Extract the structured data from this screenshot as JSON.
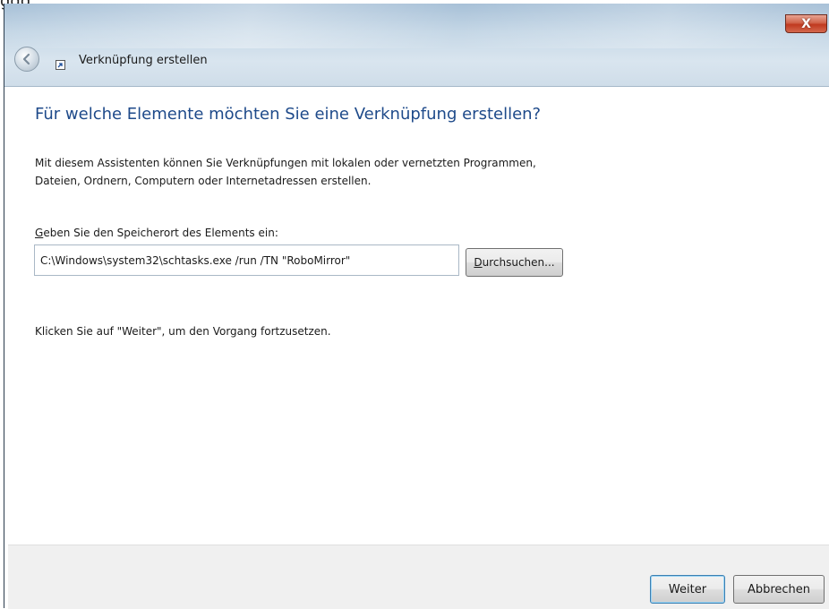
{
  "background_text": "ggg",
  "window": {
    "title": "Verknüpfung erstellen",
    "close_label": "X"
  },
  "content": {
    "heading": "Für welche Elemente möchten Sie eine Verknüpfung erstellen?",
    "description_line1": "Mit diesem Assistenten können Sie Verknüpfungen mit lokalen oder vernetzten Programmen,",
    "description_line2": "Dateien, Ordnern, Computern oder Internetadressen erstellen.",
    "field_label_accel": "G",
    "field_label_rest": "eben Sie den Speicherort des Elements ein:",
    "location_value": "C:\\Windows\\system32\\schtasks.exe /run /TN \"RoboMirror\"",
    "browse_accel": "D",
    "browse_rest": "urchsuchen...",
    "hint": "Klicken Sie auf \"Weiter\", um den Vorgang fortzusetzen."
  },
  "footer": {
    "next_label": "Weiter",
    "cancel_label": "Abbrechen"
  }
}
